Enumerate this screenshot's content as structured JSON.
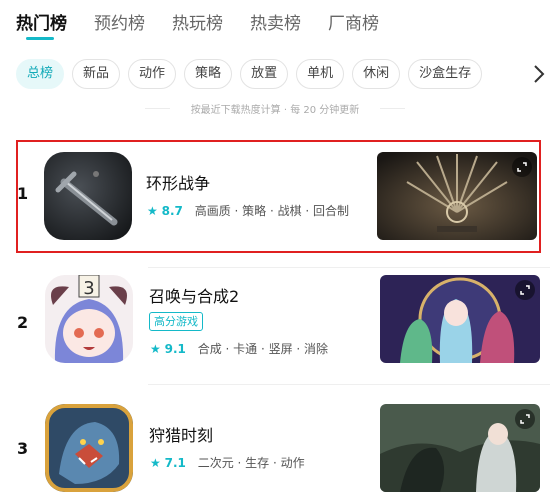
{
  "tabs": [
    {
      "label": "热门榜",
      "active": true
    },
    {
      "label": "预约榜",
      "active": false
    },
    {
      "label": "热玩榜",
      "active": false
    },
    {
      "label": "热卖榜",
      "active": false
    },
    {
      "label": "厂商榜",
      "active": false
    }
  ],
  "categories": [
    "总榜",
    "新品",
    "动作",
    "策略",
    "放置",
    "单机",
    "休闲",
    "沙盒生存"
  ],
  "active_category": "总榜",
  "note": "按最近下载热度计算 · 每 20 分钟更新",
  "games": [
    {
      "rank": "1",
      "name": "环形战争",
      "score": "8.7",
      "tags": "高画质 · 策略 · 战棋 · 回合制",
      "badge": "",
      "highlighted": true
    },
    {
      "rank": "2",
      "name": "召唤与合成2",
      "score": "9.1",
      "tags": "合成 · 卡通 · 竖屏 · 消除",
      "badge": "高分游戏",
      "highlighted": false
    },
    {
      "rank": "3",
      "name": "狩猎时刻",
      "score": "7.1",
      "tags": "二次元 · 生存 · 动作",
      "badge": "",
      "highlighted": false
    }
  ],
  "icons": {
    "rating": "star-icon",
    "chips_more": "chevron-right-icon",
    "screenshot_action": "expand-icon"
  },
  "colors": {
    "accent": "#14b9c8",
    "highlight_border": "#e02020"
  }
}
